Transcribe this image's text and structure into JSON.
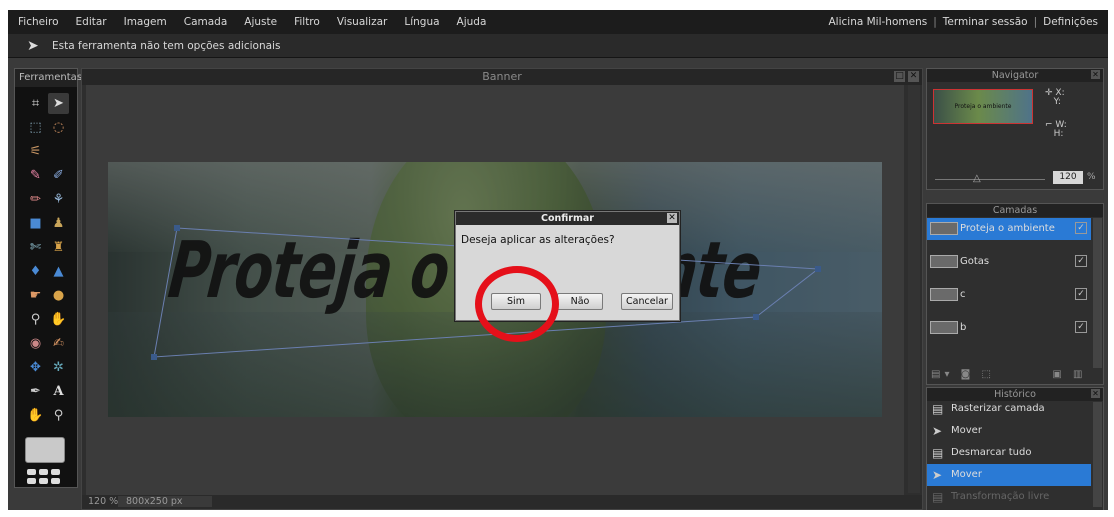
{
  "menubar": {
    "items": [
      "Ficheiro",
      "Editar",
      "Imagem",
      "Camada",
      "Ajuste",
      "Filtro",
      "Visualizar",
      "Língua",
      "Ajuda"
    ],
    "user": "Alicina Mil-homens",
    "logout": "Terminar sessão",
    "settings": "Definições",
    "separator": "|"
  },
  "options": {
    "message": "Esta ferramenta não tem opções adicionais"
  },
  "tools_panel": {
    "title": "Ferramentas"
  },
  "canvas": {
    "title": "Banner",
    "image_text": "Proteja o ambiente",
    "zoom": "120 %",
    "size": "800x250 px"
  },
  "dialog": {
    "title": "Confirmar",
    "close": "✕",
    "message": "Deseja aplicar as alterações?",
    "buttons": {
      "yes": "Sim",
      "no": "Não",
      "cancel": "Cancelar"
    }
  },
  "navigator": {
    "title": "Navigator",
    "thumb_text": "Proteja o ambiente",
    "x_label": "X:",
    "y_label": "Y:",
    "w_label": "W:",
    "h_label": "H:",
    "zoom": "120",
    "percent": "%"
  },
  "layers": {
    "title": "Camadas",
    "items": [
      {
        "name": "Proteja o ambiente",
        "checked": "✓"
      },
      {
        "name": "Gotas",
        "checked": "✓"
      },
      {
        "name": "c",
        "checked": "✓"
      },
      {
        "name": "b",
        "checked": "✓"
      }
    ]
  },
  "history": {
    "title": "Histórico",
    "items": [
      "Rasterizar camada",
      "Mover",
      "Desmarcar tudo",
      "Mover",
      "Transformação livre"
    ]
  },
  "colors": {
    "selection": "#2a7ad5",
    "highlight_ring": "#e5101a"
  }
}
